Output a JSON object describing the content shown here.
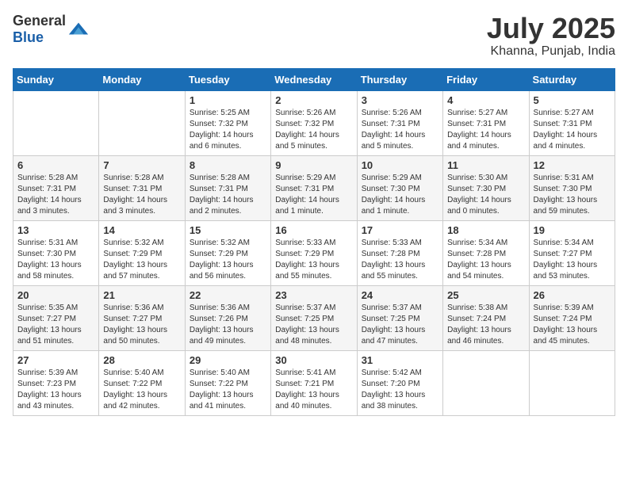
{
  "header": {
    "logo_general": "General",
    "logo_blue": "Blue",
    "month": "July 2025",
    "location": "Khanna, Punjab, India"
  },
  "weekdays": [
    "Sunday",
    "Monday",
    "Tuesday",
    "Wednesday",
    "Thursday",
    "Friday",
    "Saturday"
  ],
  "weeks": [
    [
      {
        "day": "",
        "sunrise": "",
        "sunset": "",
        "daylight": ""
      },
      {
        "day": "",
        "sunrise": "",
        "sunset": "",
        "daylight": ""
      },
      {
        "day": "1",
        "sunrise": "Sunrise: 5:25 AM",
        "sunset": "Sunset: 7:32 PM",
        "daylight": "Daylight: 14 hours and 6 minutes."
      },
      {
        "day": "2",
        "sunrise": "Sunrise: 5:26 AM",
        "sunset": "Sunset: 7:32 PM",
        "daylight": "Daylight: 14 hours and 5 minutes."
      },
      {
        "day": "3",
        "sunrise": "Sunrise: 5:26 AM",
        "sunset": "Sunset: 7:31 PM",
        "daylight": "Daylight: 14 hours and 5 minutes."
      },
      {
        "day": "4",
        "sunrise": "Sunrise: 5:27 AM",
        "sunset": "Sunset: 7:31 PM",
        "daylight": "Daylight: 14 hours and 4 minutes."
      },
      {
        "day": "5",
        "sunrise": "Sunrise: 5:27 AM",
        "sunset": "Sunset: 7:31 PM",
        "daylight": "Daylight: 14 hours and 4 minutes."
      }
    ],
    [
      {
        "day": "6",
        "sunrise": "Sunrise: 5:28 AM",
        "sunset": "Sunset: 7:31 PM",
        "daylight": "Daylight: 14 hours and 3 minutes."
      },
      {
        "day": "7",
        "sunrise": "Sunrise: 5:28 AM",
        "sunset": "Sunset: 7:31 PM",
        "daylight": "Daylight: 14 hours and 3 minutes."
      },
      {
        "day": "8",
        "sunrise": "Sunrise: 5:28 AM",
        "sunset": "Sunset: 7:31 PM",
        "daylight": "Daylight: 14 hours and 2 minutes."
      },
      {
        "day": "9",
        "sunrise": "Sunrise: 5:29 AM",
        "sunset": "Sunset: 7:31 PM",
        "daylight": "Daylight: 14 hours and 1 minute."
      },
      {
        "day": "10",
        "sunrise": "Sunrise: 5:29 AM",
        "sunset": "Sunset: 7:30 PM",
        "daylight": "Daylight: 14 hours and 1 minute."
      },
      {
        "day": "11",
        "sunrise": "Sunrise: 5:30 AM",
        "sunset": "Sunset: 7:30 PM",
        "daylight": "Daylight: 14 hours and 0 minutes."
      },
      {
        "day": "12",
        "sunrise": "Sunrise: 5:31 AM",
        "sunset": "Sunset: 7:30 PM",
        "daylight": "Daylight: 13 hours and 59 minutes."
      }
    ],
    [
      {
        "day": "13",
        "sunrise": "Sunrise: 5:31 AM",
        "sunset": "Sunset: 7:30 PM",
        "daylight": "Daylight: 13 hours and 58 minutes."
      },
      {
        "day": "14",
        "sunrise": "Sunrise: 5:32 AM",
        "sunset": "Sunset: 7:29 PM",
        "daylight": "Daylight: 13 hours and 57 minutes."
      },
      {
        "day": "15",
        "sunrise": "Sunrise: 5:32 AM",
        "sunset": "Sunset: 7:29 PM",
        "daylight": "Daylight: 13 hours and 56 minutes."
      },
      {
        "day": "16",
        "sunrise": "Sunrise: 5:33 AM",
        "sunset": "Sunset: 7:29 PM",
        "daylight": "Daylight: 13 hours and 55 minutes."
      },
      {
        "day": "17",
        "sunrise": "Sunrise: 5:33 AM",
        "sunset": "Sunset: 7:28 PM",
        "daylight": "Daylight: 13 hours and 55 minutes."
      },
      {
        "day": "18",
        "sunrise": "Sunrise: 5:34 AM",
        "sunset": "Sunset: 7:28 PM",
        "daylight": "Daylight: 13 hours and 54 minutes."
      },
      {
        "day": "19",
        "sunrise": "Sunrise: 5:34 AM",
        "sunset": "Sunset: 7:27 PM",
        "daylight": "Daylight: 13 hours and 53 minutes."
      }
    ],
    [
      {
        "day": "20",
        "sunrise": "Sunrise: 5:35 AM",
        "sunset": "Sunset: 7:27 PM",
        "daylight": "Daylight: 13 hours and 51 minutes."
      },
      {
        "day": "21",
        "sunrise": "Sunrise: 5:36 AM",
        "sunset": "Sunset: 7:27 PM",
        "daylight": "Daylight: 13 hours and 50 minutes."
      },
      {
        "day": "22",
        "sunrise": "Sunrise: 5:36 AM",
        "sunset": "Sunset: 7:26 PM",
        "daylight": "Daylight: 13 hours and 49 minutes."
      },
      {
        "day": "23",
        "sunrise": "Sunrise: 5:37 AM",
        "sunset": "Sunset: 7:25 PM",
        "daylight": "Daylight: 13 hours and 48 minutes."
      },
      {
        "day": "24",
        "sunrise": "Sunrise: 5:37 AM",
        "sunset": "Sunset: 7:25 PM",
        "daylight": "Daylight: 13 hours and 47 minutes."
      },
      {
        "day": "25",
        "sunrise": "Sunrise: 5:38 AM",
        "sunset": "Sunset: 7:24 PM",
        "daylight": "Daylight: 13 hours and 46 minutes."
      },
      {
        "day": "26",
        "sunrise": "Sunrise: 5:39 AM",
        "sunset": "Sunset: 7:24 PM",
        "daylight": "Daylight: 13 hours and 45 minutes."
      }
    ],
    [
      {
        "day": "27",
        "sunrise": "Sunrise: 5:39 AM",
        "sunset": "Sunset: 7:23 PM",
        "daylight": "Daylight: 13 hours and 43 minutes."
      },
      {
        "day": "28",
        "sunrise": "Sunrise: 5:40 AM",
        "sunset": "Sunset: 7:22 PM",
        "daylight": "Daylight: 13 hours and 42 minutes."
      },
      {
        "day": "29",
        "sunrise": "Sunrise: 5:40 AM",
        "sunset": "Sunset: 7:22 PM",
        "daylight": "Daylight: 13 hours and 41 minutes."
      },
      {
        "day": "30",
        "sunrise": "Sunrise: 5:41 AM",
        "sunset": "Sunset: 7:21 PM",
        "daylight": "Daylight: 13 hours and 40 minutes."
      },
      {
        "day": "31",
        "sunrise": "Sunrise: 5:42 AM",
        "sunset": "Sunset: 7:20 PM",
        "daylight": "Daylight: 13 hours and 38 minutes."
      },
      {
        "day": "",
        "sunrise": "",
        "sunset": "",
        "daylight": ""
      },
      {
        "day": "",
        "sunrise": "",
        "sunset": "",
        "daylight": ""
      }
    ]
  ]
}
